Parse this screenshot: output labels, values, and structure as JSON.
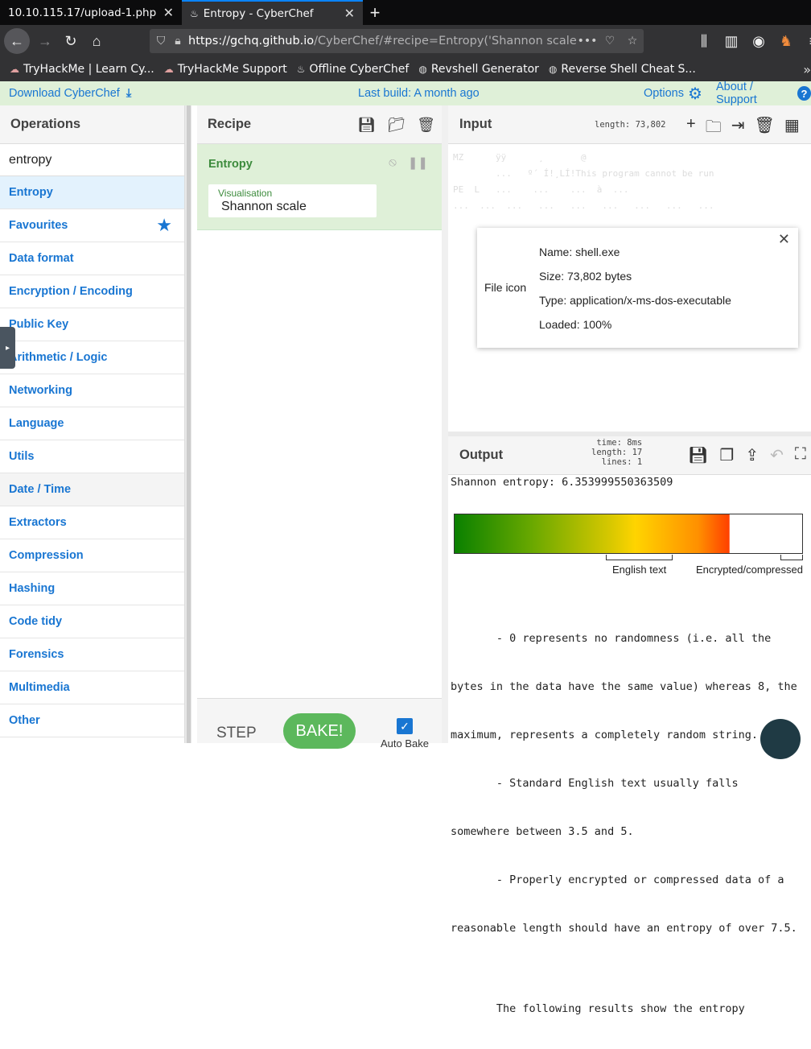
{
  "browser": {
    "tabs": [
      {
        "title": "10.10.115.17/upload-1.php",
        "active": false
      },
      {
        "title": "Entropy - CyberChef",
        "active": true
      }
    ],
    "url_host": "https://gchq.github.io",
    "url_rest": "/CyberChef/#recipe=Entropy('Shannon scale'",
    "bookmarks": [
      "TryHackMe | Learn Cy...",
      "TryHackMe Support",
      "Offline CyberChef",
      "Revshell Generator",
      "Reverse Shell Cheat S..."
    ]
  },
  "banner": {
    "download": "Download CyberChef",
    "build": "Last build: A month ago",
    "options": "Options",
    "about": "About / Support"
  },
  "operations": {
    "title": "Operations",
    "search": "entropy",
    "items": [
      "Entropy",
      "Favourites",
      "Data format",
      "Encryption / Encoding",
      "Public Key",
      "Arithmetic / Logic",
      "Networking",
      "Language",
      "Utils",
      "Date / Time",
      "Extractors",
      "Compression",
      "Hashing",
      "Code tidy",
      "Forensics",
      "Multimedia",
      "Other"
    ]
  },
  "recipe": {
    "title": "Recipe",
    "ingredient": "Entropy",
    "arg_label": "Visualisation",
    "arg_value": "Shannon scale",
    "step": "STEP",
    "bake": "BAKE!",
    "autobake": "Auto Bake"
  },
  "input": {
    "title": "Input",
    "length": "length: 73,802",
    "file_icon": "File icon",
    "name": "Name: shell.exe",
    "size": "Size: 73,802 bytes",
    "type": "Type: application/x-ms-dos-executable",
    "loaded": "Loaded: 100%"
  },
  "output": {
    "title": "Output",
    "time": "time:  8ms",
    "length": "length:  17",
    "lines": "lines:   1",
    "entropy_line": "Shannon entropy: 6.353999550363509",
    "label_english": "English text",
    "label_encrypted": "Encrypted/compressed",
    "notes": [
      "       - 0 represents no randomness (i.e. all the",
      "bytes in the data have the same value) whereas 8, the",
      "maximum, represents a completely random string.",
      "       - Standard English text usually falls",
      "somewhere between 3.5 and 5.",
      "       - Properly encrypted or compressed data of a",
      "reasonable length should have an entropy of over 7.5.",
      "",
      "       The following results show the entropy"
    ]
  },
  "colors": {
    "accent": "#1976d2",
    "recipe_green": "#dff0d8",
    "bake_green": "#5cb85c"
  }
}
